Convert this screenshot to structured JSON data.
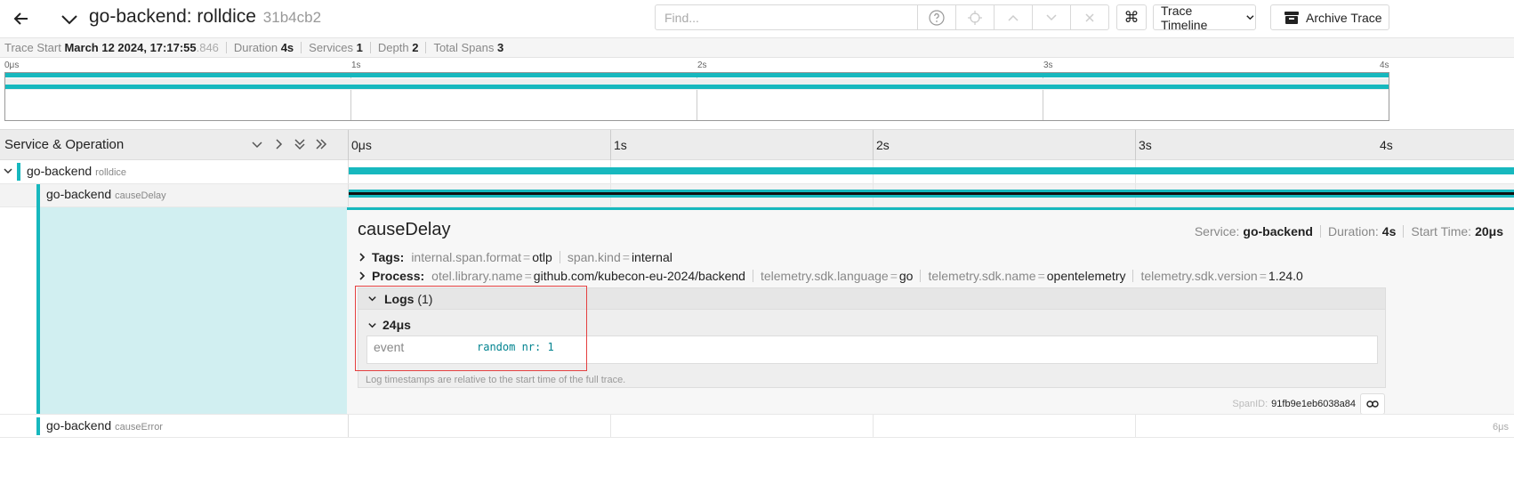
{
  "header": {
    "title": "go-backend: rolldice",
    "trace_id": "31b4cb2",
    "search_placeholder": "Find...",
    "view_select": "Trace Timeline",
    "archive_label": "Archive Trace"
  },
  "summary": {
    "trace_start_label": "Trace Start",
    "trace_start_value": "March 12 2024, 17:17:55",
    "trace_start_ms": ".846",
    "duration_label": "Duration",
    "duration_value": "4s",
    "services_label": "Services",
    "services_value": "1",
    "depth_label": "Depth",
    "depth_value": "2",
    "total_spans_label": "Total Spans",
    "total_spans_value": "3"
  },
  "minimap": {
    "ticks": [
      "0μs",
      "1s",
      "2s",
      "3s",
      "4s"
    ]
  },
  "timeline": {
    "column_title": "Service & Operation",
    "ticks": [
      "0μs",
      "1s",
      "2s",
      "3s",
      "4s"
    ]
  },
  "spans": [
    {
      "service": "go-backend",
      "operation": "rolldice"
    },
    {
      "service": "go-backend",
      "operation": "causeDelay"
    },
    {
      "service": "go-backend",
      "operation": "causeError",
      "duration_label": "6μs"
    }
  ],
  "detail": {
    "operation": "causeDelay",
    "service_label": "Service:",
    "service_value": "go-backend",
    "duration_label": "Duration:",
    "duration_value": "4s",
    "start_label": "Start Time:",
    "start_value": "20μs",
    "tags_label": "Tags:",
    "tags": [
      {
        "key": "internal.span.format",
        "value": "otlp"
      },
      {
        "key": "span.kind",
        "value": "internal"
      }
    ],
    "process_label": "Process:",
    "process": [
      {
        "key": "otel.library.name",
        "value": "github.com/kubecon-eu-2024/backend"
      },
      {
        "key": "telemetry.sdk.language",
        "value": "go"
      },
      {
        "key": "telemetry.sdk.name",
        "value": "opentelemetry"
      },
      {
        "key": "telemetry.sdk.version",
        "value": "1.24.0"
      }
    ],
    "logs_label": "Logs",
    "logs_count": "(1)",
    "log_time": "24μs",
    "log_key": "event",
    "log_value": "random nr: 1",
    "log_note": "Log timestamps are relative to the start time of the full trace.",
    "span_id_label": "SpanID:",
    "span_id_value": "91fb9e1eb6038a84"
  },
  "colors": {
    "accent": "#17b8be",
    "highlight": "#e54040",
    "selected_bg": "#d1eff1"
  }
}
